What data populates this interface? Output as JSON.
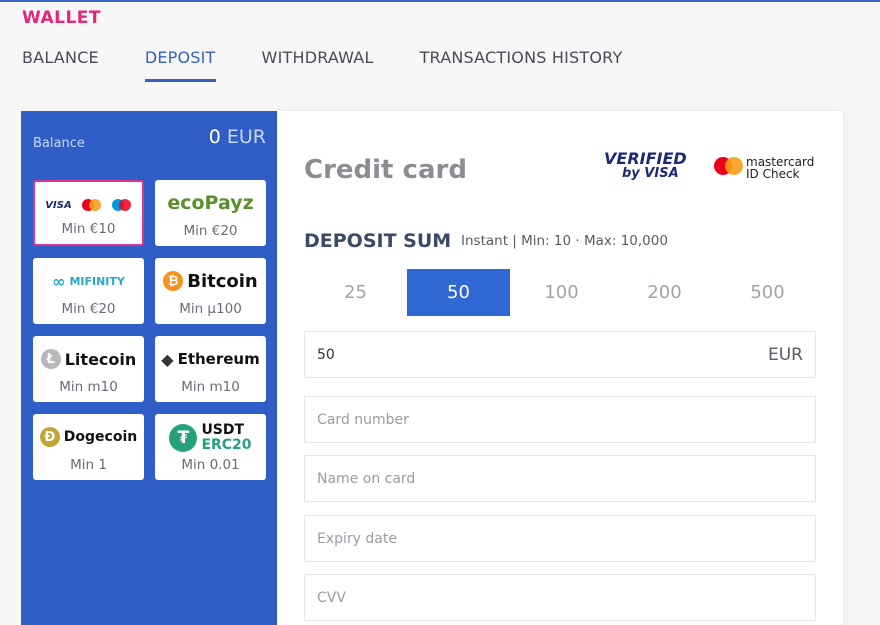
{
  "wallet": {
    "title": "WALLET"
  },
  "tabs": [
    {
      "label": "BALANCE"
    },
    {
      "label": "DEPOSIT"
    },
    {
      "label": "WITHDRAWAL"
    },
    {
      "label": "TRANSACTIONS HISTORY"
    }
  ],
  "balance": {
    "label": "Balance",
    "amount": "0",
    "currency": "EUR"
  },
  "methods": [
    {
      "name": "VISA",
      "min": "Min €10"
    },
    {
      "name": "ecoPayz",
      "min": "Min €20"
    },
    {
      "name": "MIFINITY",
      "min": "Min €20"
    },
    {
      "name": "Bitcoin",
      "min": "Min µ100"
    },
    {
      "name": "Litecoin",
      "min": "Min m10"
    },
    {
      "name": "Ethereum",
      "min": "Min m10"
    },
    {
      "name": "Dogecoin",
      "min": "Min 1"
    },
    {
      "name": "USDT",
      "sub": "ERC20",
      "min": "Min 0.01"
    }
  ],
  "main": {
    "title": "Credit card",
    "verified": {
      "line1": "VERIFIED",
      "line2": "by VISA"
    },
    "mastercard": {
      "line1": "mastercard",
      "line2": "ID Check"
    },
    "deposit_sum": "DEPOSIT SUM",
    "deposit_info": "Instant | Min: 10 · Max: 10,000",
    "amounts": [
      "25",
      "50",
      "100",
      "200",
      "500"
    ],
    "sum_value": "50",
    "sum_currency": "EUR",
    "card_number_placeholder": "Card number",
    "name_placeholder": "Name on card",
    "expiry_placeholder": "Expiry date",
    "cvv_placeholder": "CVV"
  },
  "colors": {
    "accent": "#2f5fc6",
    "brand_pink": "#e4267a",
    "selected_amount": "#2f67d3"
  }
}
